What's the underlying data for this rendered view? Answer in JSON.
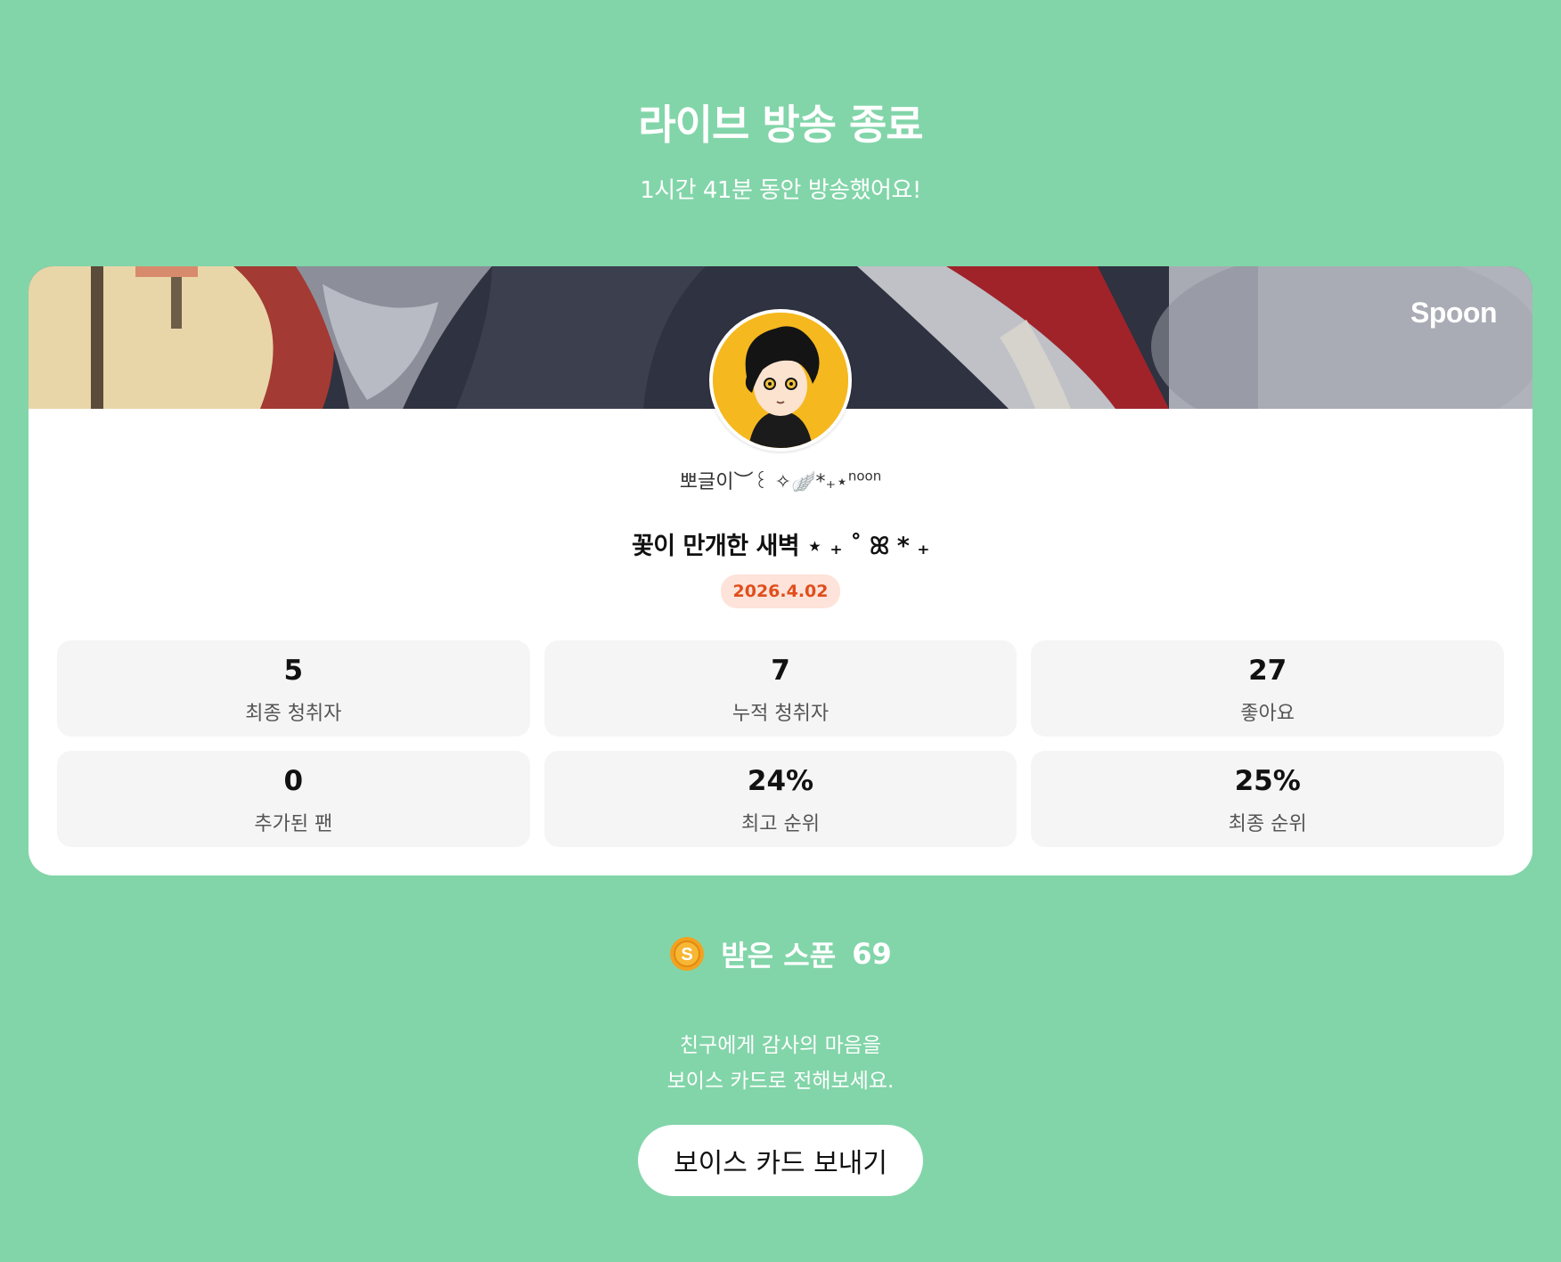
{
  "header": {
    "title": "라이브 방송 종료",
    "subtitle": "1시간 41분 동안 방송했어요!"
  },
  "card": {
    "brand": "Spoon",
    "nickname": "뽀글이︶꒰ ✧🪽*₊⋆",
    "nickname_sup": "noon",
    "live_title": "꽃이 만개한 새벽 ⋆ ₊ ˚ ꕤ * ₊",
    "date": "2026.4.02",
    "stats": [
      {
        "value": "5",
        "label": "최종 청취자"
      },
      {
        "value": "7",
        "label": "누적 청취자"
      },
      {
        "value": "27",
        "label": "좋아요"
      },
      {
        "value": "0",
        "label": "추가된 팬"
      },
      {
        "value": "24%",
        "label": "최고 순위"
      },
      {
        "value": "25%",
        "label": "최종 순위"
      }
    ]
  },
  "spoons": {
    "label": "받은 스푼",
    "count": "69",
    "icon": "coin-icon"
  },
  "thanks": {
    "line1": "친구에게 감사의 마음을",
    "line2": "보이스 카드로 전해보세요."
  },
  "cta": {
    "label": "보이스 카드 보내기"
  },
  "colors": {
    "background": "#82d5a9",
    "date_badge_bg": "#fde3d9",
    "date_badge_text": "#e04e1c",
    "stat_bg": "#f5f5f5"
  }
}
